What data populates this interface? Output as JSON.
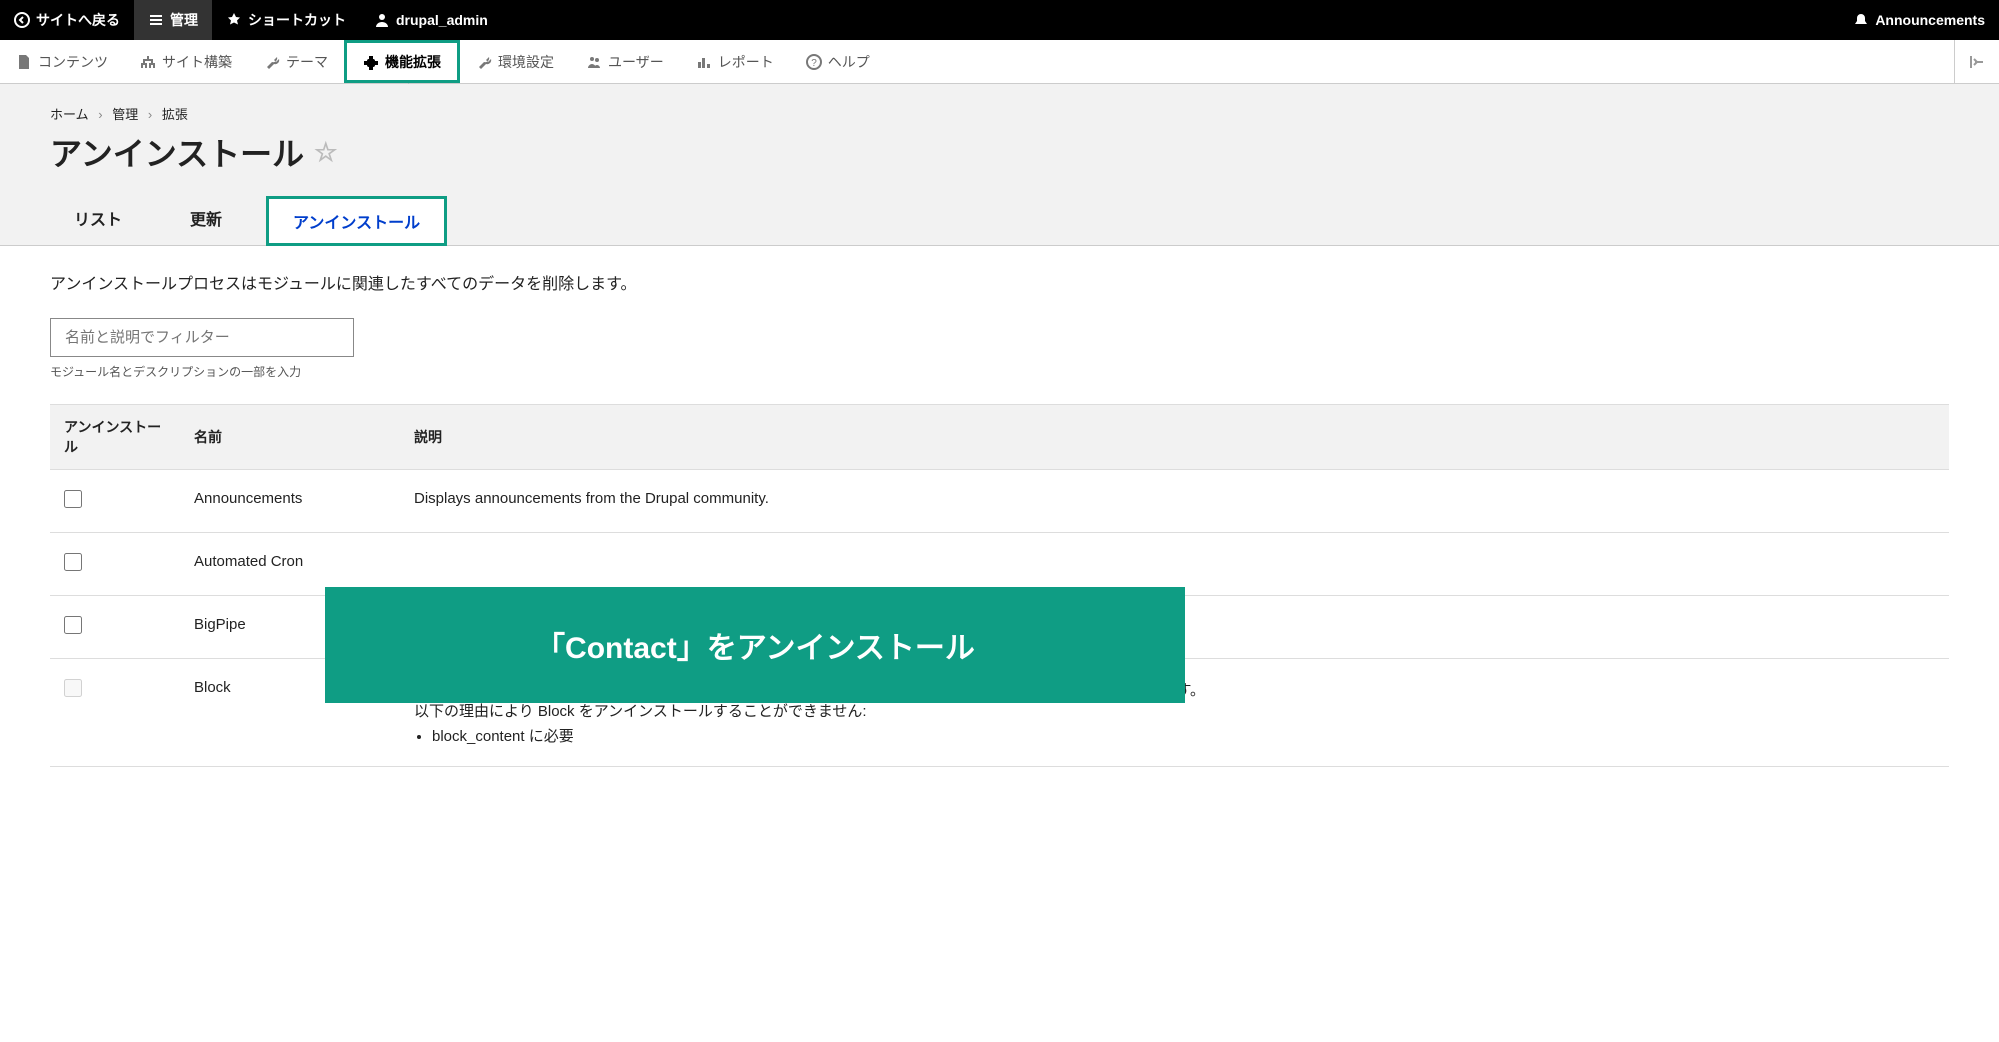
{
  "toolbar_top": {
    "back": "サイトへ戻る",
    "manage": "管理",
    "shortcuts": "ショートカット",
    "user": "drupal_admin",
    "announcements": "Announcements"
  },
  "toolbar_admin": {
    "content": "コンテンツ",
    "structure": "サイト構築",
    "appearance": "テーマ",
    "extend": "機能拡張",
    "config": "環境設定",
    "people": "ユーザー",
    "reports": "レポート",
    "help": "ヘルプ"
  },
  "breadcrumb": {
    "home": "ホーム",
    "admin": "管理",
    "extend": "拡張"
  },
  "page_title": "アンインストール",
  "tabs": {
    "list": "リスト",
    "update": "更新",
    "uninstall": "アンインストール"
  },
  "help_text": "アンインストールプロセスはモジュールに関連したすべてのデータを削除します。",
  "filter": {
    "placeholder": "名前と説明でフィルター",
    "help": "モジュール名とデスクリプションの一部を入力"
  },
  "table": {
    "headers": {
      "uninstall": "アンインストール",
      "name": "名前",
      "desc": "説明"
    },
    "rows": [
      {
        "name": "Announcements",
        "desc": "Displays announcements from the Drupal community.",
        "disabled": false
      },
      {
        "name": "Automated Cron",
        "desc": "",
        "disabled": false
      },
      {
        "name": "BigPipe",
        "desc": "",
        "disabled": false
      },
      {
        "name": "Block",
        "desc": "ユーザーがブロック（コンテンツ、フォームなどを含む）を設定し、テーマのリージョンに配置できるようにします。\n以下の理由により Block をアンインストールすることができません:",
        "reason": "block_content に必要",
        "disabled": true
      }
    ]
  },
  "overlay": "「Contact」をアンインストール"
}
